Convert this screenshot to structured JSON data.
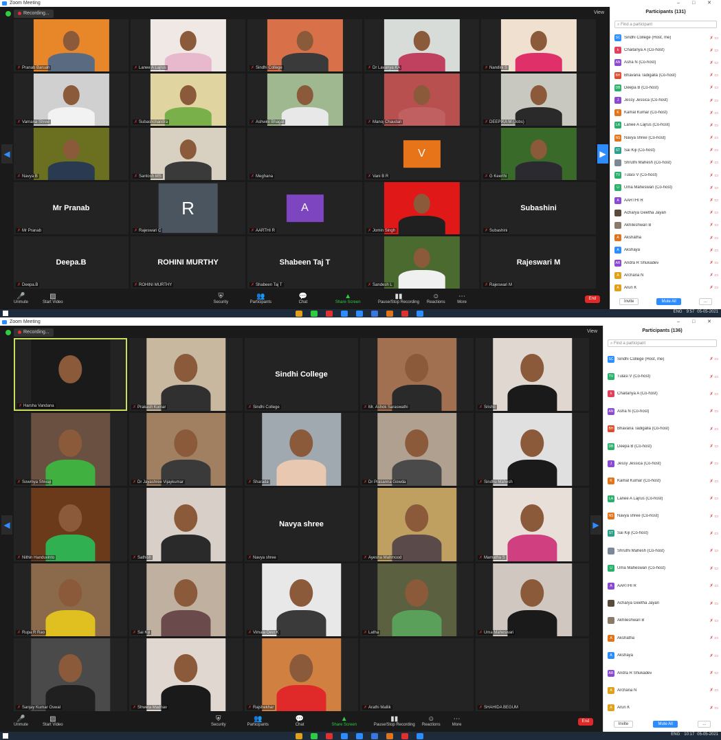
{
  "window": {
    "title": "Zoom Meeting",
    "controls": "–  □  ✕"
  },
  "meeting": {
    "recording_label": "Recording...",
    "view_label": "View"
  },
  "screen1": {
    "tiles": [
      {
        "name": "Pranab Baruah",
        "type": "photo",
        "bg": "#e8862a",
        "shirt": "#5a6a80"
      },
      {
        "name": "Lanee A Lajrus",
        "type": "photo",
        "bg": "#f0e8e4",
        "shirt": "#e8b8cc"
      },
      {
        "name": "Sindhi College",
        "type": "photo",
        "bg": "#d8704a",
        "shirt": "#3a3a3a"
      },
      {
        "name": "Dr Lavanya KA",
        "type": "photo",
        "bg": "#d8dcd8",
        "shirt": "#c04060"
      },
      {
        "name": "Nandini S",
        "type": "photo",
        "bg": "#f0e0d0",
        "shirt": "#e0306a"
      },
      {
        "name": "Varnana Shree",
        "type": "photo",
        "bg": "#d0d0d0",
        "shirt": "#f2f2f2"
      },
      {
        "name": "Subashchandra",
        "type": "photo",
        "bg": "#e0d4a0",
        "shirt": "#7ab04a"
      },
      {
        "name": "Ashwini Bhagat",
        "type": "photo",
        "bg": "#a0b890",
        "shirt": "#e8e8e8"
      },
      {
        "name": "Manoj Chaudari",
        "type": "photo",
        "bg": "#b85050",
        "shirt": "#c06060"
      },
      {
        "name": "DEEPIKA M (Jobs)",
        "type": "photo",
        "bg": "#c8c8c0",
        "shirt": "#2a2a2a"
      },
      {
        "name": "Navya B",
        "type": "photo",
        "bg": "#6a7020",
        "shirt": "#2a3a50"
      },
      {
        "name": "Santosh MS",
        "type": "photo",
        "bg": "#d8d0c0",
        "shirt": "#3a3a3a"
      },
      {
        "name": "Meghana",
        "type": "empty"
      },
      {
        "name": "Vani B R",
        "type": "letter",
        "letter": "V",
        "bg": "#e8741a"
      },
      {
        "name": "G Keerthi",
        "type": "photo",
        "bg": "#3a6a2a",
        "shirt": "#2a2a30"
      },
      {
        "name": "Mr Pranab",
        "type": "name"
      },
      {
        "name": "Rajeswari C",
        "type": "letter",
        "letter": "R",
        "bg": "#4a5560"
      },
      {
        "name": "AARTHI R",
        "type": "letter",
        "letter": "A",
        "bg": "#7e45c0"
      },
      {
        "name": "Jomin Singh",
        "type": "photo",
        "bg": "#e01818",
        "shirt": "#202020"
      },
      {
        "name": "Subashini",
        "type": "name"
      },
      {
        "name": "Deepa.B",
        "type": "name"
      },
      {
        "name": "ROHINI MURTHY",
        "type": "name"
      },
      {
        "name": "Shabeen Taj T",
        "type": "name"
      },
      {
        "name": "Sandesh L",
        "type": "photo",
        "bg": "#4a6a30",
        "shirt": "#f0f0f0"
      },
      {
        "name": "Rajeswari M",
        "type": "name"
      }
    ],
    "participants_title": "Participants (131)",
    "search_placeholder": "Find a participant",
    "participants": [
      {
        "i": "SC",
        "c": "#2d8cff",
        "n": "Sindhi College (Host, me)"
      },
      {
        "i": "k",
        "c": "#e0405a",
        "n": "Chaitanya A (Co-host)"
      },
      {
        "i": "AN",
        "c": "#8a4ad0",
        "n": "Asha N (Co-host)"
      },
      {
        "i": "BH",
        "c": "#e04a2a",
        "n": "Bhavana Tadigalla (Co-host)"
      },
      {
        "i": "DB",
        "c": "#2ab06a",
        "n": "Deepa B (Co-host)"
      },
      {
        "i": "J",
        "c": "#8a4ad0",
        "n": "Jessy Jessica (Co-host)"
      },
      {
        "i": "K",
        "c": "#e0741a",
        "n": "Kamal Kumar (Co-host)"
      },
      {
        "i": "LA",
        "c": "#2ab06a",
        "n": "Lanee A Lajrus (Co-host)"
      },
      {
        "i": "NS",
        "c": "#e0741a",
        "n": "Navya shree (Co-host)"
      },
      {
        "i": "ST",
        "c": "#2aa08a",
        "n": "Sai Kiji (Co-host)"
      },
      {
        "i": "",
        "c": "#7a8898",
        "n": "Shruthi Mahesh (Co-host)"
      },
      {
        "i": "TV",
        "c": "#2ab06a",
        "n": "Tulasi V (Co-host)"
      },
      {
        "i": "U",
        "c": "#2ab06a",
        "n": "Uma Maheswari (Co-host)"
      },
      {
        "i": "A",
        "c": "#8a4ad0",
        "n": "AARTHI R"
      },
      {
        "i": "",
        "c": "#5a4a3a",
        "n": "Acharya Geetha Jayan"
      },
      {
        "i": "",
        "c": "#8a7a6a",
        "n": "Akhileshwari B"
      },
      {
        "i": "A",
        "c": "#e0741a",
        "n": "Akshatha"
      },
      {
        "i": "A",
        "c": "#2d8cff",
        "n": "Akshaya"
      },
      {
        "i": "AR",
        "c": "#8a4ad0",
        "n": "Andra R Shukadev"
      },
      {
        "i": "A",
        "c": "#e0a01a",
        "n": "Archana N"
      },
      {
        "i": "A",
        "c": "#e0a01a",
        "n": "Arun K"
      }
    ],
    "invite": "Invite",
    "mute_all": "Mute All",
    "more": "...",
    "clock": "9:57",
    "date": "05-05-2021",
    "lang": "ENG"
  },
  "screen2": {
    "tiles": [
      {
        "name": "Harsha Vandana",
        "type": "photo",
        "bg": "#1a1a1a",
        "shirt": "#1a1a1a",
        "highlight": true
      },
      {
        "name": "Prakash Kumar",
        "type": "photo",
        "bg": "#c8b8a0",
        "shirt": "#303030"
      },
      {
        "name": "Sindhi College",
        "type": "name"
      },
      {
        "name": "Mr. Ashok Saraswathi",
        "type": "photo",
        "bg": "#a07050",
        "shirt": "#2a2a2a"
      },
      {
        "name": "Srishti",
        "type": "photo",
        "bg": "#e0d8d0",
        "shirt": "#1a1a1a"
      },
      {
        "name": "Sowmya Shivaji",
        "type": "photo",
        "bg": "#6a5040",
        "shirt": "#40b040"
      },
      {
        "name": "Dr Jayashree Vijaykumar",
        "type": "photo",
        "bg": "#a08060",
        "shirt": "#3a3a3a"
      },
      {
        "name": "Sharada",
        "type": "photo",
        "bg": "#a0a8b0",
        "shirt": "#e8c8b0"
      },
      {
        "name": "Dr Prasanna Gowda",
        "type": "photo",
        "bg": "#b0a090",
        "shirt": "#4a4a4a"
      },
      {
        "name": "Sindhu Mahesh",
        "type": "photo",
        "bg": "#e0e0e0",
        "shirt": "#1a1a1a"
      },
      {
        "name": "Nithin Handuvinto",
        "type": "photo",
        "bg": "#6a3a1a",
        "shirt": "#30b050"
      },
      {
        "name": "Sathish",
        "type": "photo",
        "bg": "#d8d0c8",
        "shirt": "#2a2a2a"
      },
      {
        "name": "Navya shree",
        "type": "name"
      },
      {
        "name": "Ayesha Mahmood",
        "type": "photo",
        "bg": "#c0a060",
        "shirt": "#5a4a4a"
      },
      {
        "name": "Mamatha S",
        "type": "photo",
        "bg": "#e8e0d8",
        "shirt": "#d04080"
      },
      {
        "name": "Rupa R Rao",
        "type": "photo",
        "bg": "#8a6a4a",
        "shirt": "#e0c020"
      },
      {
        "name": "Sai Kiji",
        "type": "photo",
        "bg": "#c0b0a0",
        "shirt": "#6a4a4a"
      },
      {
        "name": "Vimala Devi K",
        "type": "photo",
        "bg": "#e8e8e8",
        "shirt": "#3a3a3a"
      },
      {
        "name": "Latha",
        "type": "photo",
        "bg": "#5a6040",
        "shirt": "#5aa05a"
      },
      {
        "name": "Uma Maheswari",
        "type": "photo",
        "bg": "#d0c8c0",
        "shirt": "#1a1a1a"
      },
      {
        "name": "Sanjay Kumar Oswal",
        "type": "photo",
        "bg": "#4a4a4a",
        "shirt": "#202020"
      },
      {
        "name": "Shweta Madhav",
        "type": "photo",
        "bg": "#e0d8d0",
        "shirt": "#1a1a1a"
      },
      {
        "name": "Rajshekhar",
        "type": "photo",
        "bg": "#d08040",
        "shirt": "#e02a2a"
      },
      {
        "name": "Arathi Mallik",
        "type": "empty"
      },
      {
        "name": "SHAHIDA BEGUM",
        "type": "empty"
      }
    ],
    "participants_title": "Participants (136)",
    "search_placeholder": "Find a participant",
    "participants": [
      {
        "i": "SC",
        "c": "#2d8cff",
        "n": "Sindhi College (Host, me)"
      },
      {
        "i": "TV",
        "c": "#2ab06a",
        "n": "Tulasi V (Co-host)"
      },
      {
        "i": "k",
        "c": "#e0405a",
        "n": "Chaitanya A (Co-host)"
      },
      {
        "i": "AN",
        "c": "#8a4ad0",
        "n": "Asha N (Co-host)"
      },
      {
        "i": "BH",
        "c": "#e04a2a",
        "n": "Bhavana Tadigalla (Co-host)"
      },
      {
        "i": "DB",
        "c": "#2ab06a",
        "n": "Deepa B (Co-host)"
      },
      {
        "i": "J",
        "c": "#8a4ad0",
        "n": "Jessy Jessica (Co-host)"
      },
      {
        "i": "K",
        "c": "#e0741a",
        "n": "Kamal Kumar (Co-host)"
      },
      {
        "i": "LA",
        "c": "#2ab06a",
        "n": "Lanee A Lajrus (Co-host)"
      },
      {
        "i": "NS",
        "c": "#e0741a",
        "n": "Navya shree (Co-host)"
      },
      {
        "i": "ST",
        "c": "#2aa08a",
        "n": "Sai Kiji (Co-host)"
      },
      {
        "i": "",
        "c": "#7a8898",
        "n": "Shruthi Mahesh (Co-host)"
      },
      {
        "i": "U",
        "c": "#2ab06a",
        "n": "Uma Maheswari (Co-host)"
      },
      {
        "i": "A",
        "c": "#8a4ad0",
        "n": "AARTHI R"
      },
      {
        "i": "",
        "c": "#5a4a3a",
        "n": "Acharya Geetha Jayan"
      },
      {
        "i": "",
        "c": "#8a7a6a",
        "n": "Akhileshwari B"
      },
      {
        "i": "A",
        "c": "#e0741a",
        "n": "Akshatha"
      },
      {
        "i": "A",
        "c": "#2d8cff",
        "n": "Akshaya"
      },
      {
        "i": "AR",
        "c": "#8a4ad0",
        "n": "Andra R Shukadev"
      },
      {
        "i": "A",
        "c": "#e0a01a",
        "n": "Archana N"
      },
      {
        "i": "A",
        "c": "#e0a01a",
        "n": "Arun K"
      }
    ],
    "invite": "Invite",
    "mute_all": "Mute All",
    "more": "...",
    "clock": "10:17",
    "date": "05-05-2021",
    "lang": "ENG"
  },
  "toolbar": {
    "unmute": "Unmute",
    "start_video": "Start Video",
    "security": "Security",
    "participants": "Participants",
    "participants_count": "131",
    "chat": "Chat",
    "share_screen": "Share Screen",
    "pause_recording": "Pause/Stop Recording",
    "reactions": "Reactions",
    "more": "More",
    "end": "End"
  },
  "icons": {
    "mute": "muted-mic-icon",
    "video": "video-off-icon",
    "security": "shield-icon",
    "participants": "people-icon",
    "chat": "chat-icon",
    "share": "share-screen-icon",
    "record": "pause-stop-icon",
    "reactions": "smiley-icon",
    "more": "ellipsis-icon"
  }
}
